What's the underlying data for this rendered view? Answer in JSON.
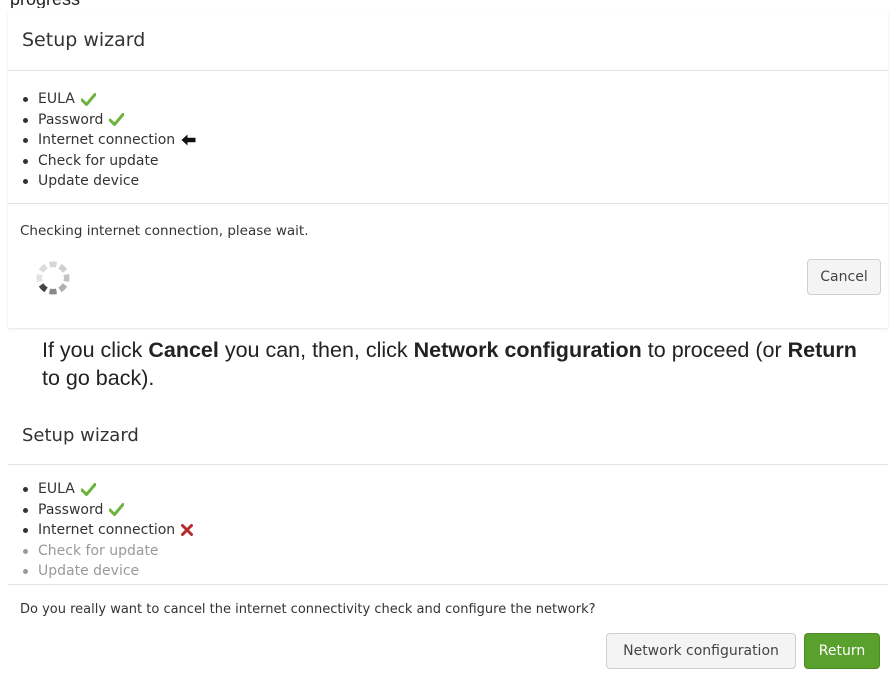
{
  "panel1": {
    "title": "Setup wizard",
    "steps": [
      {
        "label": "EULA",
        "status": "done"
      },
      {
        "label": "Password",
        "status": "done"
      },
      {
        "label": "Internet connection",
        "status": "current"
      },
      {
        "label": "Check for update",
        "status": "pending"
      },
      {
        "label": "Update device",
        "status": "pending"
      }
    ],
    "message": "Checking internet connection, please wait.",
    "cancel_label": "Cancel"
  },
  "instruction": {
    "part1": "If you click ",
    "cancel": "Cancel",
    "part2": " you can, then, click ",
    "network": "Network configuration",
    "part3": " to proceed (or ",
    "return": "Return",
    "part4": " to go back)."
  },
  "panel2": {
    "title": "Setup wizard",
    "steps": [
      {
        "label": "EULA",
        "status": "done"
      },
      {
        "label": "Password",
        "status": "done"
      },
      {
        "label": "Internet connection",
        "status": "failed"
      },
      {
        "label": "Check for update",
        "status": "disabled"
      },
      {
        "label": "Update device",
        "status": "disabled"
      }
    ],
    "message": "Do you really want to cancel the internet connectivity check and configure the network?",
    "network_label": "Network configuration",
    "return_label": "Return"
  },
  "colors": {
    "check": "#6cb33e",
    "cross": "#b52a2a",
    "primary_button": "#5aa02c"
  },
  "icons": {
    "done": "check-icon",
    "current": "arrow-left-icon",
    "failed": "cross-icon",
    "loading": "spinner-icon"
  }
}
